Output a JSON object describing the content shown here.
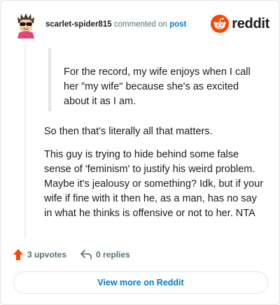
{
  "header": {
    "username": "scarlet-spider815",
    "action_text": "commented on",
    "post_link": "post",
    "brand": "reddit"
  },
  "quote": {
    "text": "For the record, my wife enjoys when I call her \"my wife\" because she's as excited about it as I am."
  },
  "body": {
    "paragraphs": [
      "So then that's literally all that matters.",
      "This guy is trying to hide behind some false sense of 'feminism' to justify his weird problem. Maybe it's jealousy or something? Idk, but if your wife if fine with it then he, as a man, has no say in what he thinks is offensive or not to her. NTA"
    ]
  },
  "actions": {
    "upvotes": "3 upvotes",
    "replies": "0 replies"
  },
  "cta": {
    "label": "View more on Reddit"
  },
  "colors": {
    "upvote": "#ff4500",
    "brand": "#ff4500",
    "link": "#0079d3",
    "muted": "#576f76"
  },
  "icons": [
    "avatar-icon",
    "reddit-logo-icon",
    "upvote-arrow-icon",
    "reply-arrow-icon"
  ]
}
